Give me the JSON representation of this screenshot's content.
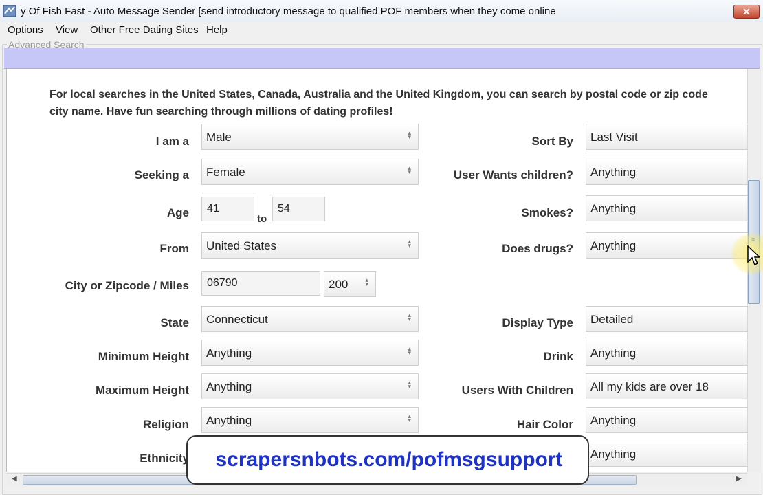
{
  "window": {
    "title": "y Of Fish Fast - Auto Message Sender    [send introductory message to qualified POF members when they come online",
    "close_label": "✕"
  },
  "menu": [
    "Options",
    "View",
    "Other Free Dating Sites",
    "Help"
  ],
  "group_label": "Advanced Search",
  "intro": {
    "line1": "For local searches in the United States, Canada, Australia and the United Kingdom, you can search by postal code or zip code",
    "line2": "city name. Have fun searching through millions of dating profiles!"
  },
  "left_fields": {
    "i_am_a": {
      "label": "I am a",
      "value": "Male"
    },
    "seeking_a": {
      "label": "Seeking a",
      "value": "Female"
    },
    "age": {
      "label": "Age",
      "from": "41",
      "to_label": "to",
      "to": "54"
    },
    "from": {
      "label": "From",
      "value": "United States"
    },
    "city_zip": {
      "label": "City or Zipcode / Miles",
      "value": "06790",
      "miles": "200"
    },
    "state": {
      "label": "State",
      "value": "Connecticut"
    },
    "min_height": {
      "label": "Minimum Height",
      "value": "Anything"
    },
    "max_height": {
      "label": "Maximum Height",
      "value": "Anything"
    },
    "religion": {
      "label": "Religion",
      "value": "Anything"
    },
    "ethnicity": {
      "label": "Ethnicity"
    }
  },
  "right_fields": {
    "sort_by": {
      "label": "Sort By",
      "value": "Last Visit"
    },
    "wants_children": {
      "label": "User Wants children?",
      "value": "Anything"
    },
    "smokes": {
      "label": "Smokes?",
      "value": "Anything"
    },
    "drugs": {
      "label": "Does drugs?",
      "value": "Anything"
    },
    "display_type": {
      "label": "Display Type",
      "value": "Detailed"
    },
    "drink": {
      "label": "Drink",
      "value": "Anything"
    },
    "with_children": {
      "label": "Users With Children",
      "value": "All my kids are over 18"
    },
    "hair_color": {
      "label": "Hair Color",
      "value": "Anything"
    },
    "last_field": {
      "value": "Anything"
    }
  },
  "overlay_banner": "scrapersnbots.com/pofmsgsupport",
  "colors": {
    "banner_text": "#1e33c4",
    "purple_band": "#c7c7f7",
    "close_button": "#c4432b"
  }
}
